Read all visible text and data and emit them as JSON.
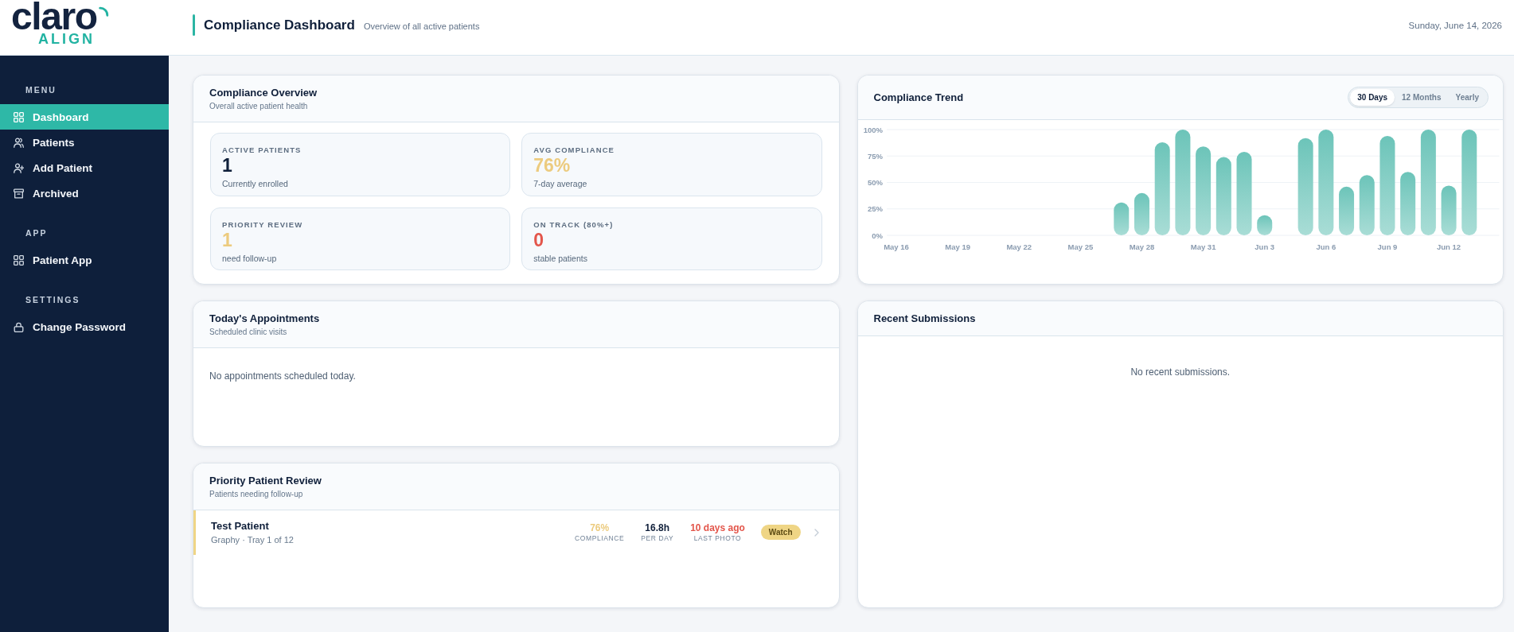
{
  "header": {
    "logo": {
      "wordmark": "claro",
      "tagline": "ALIGN"
    },
    "title": "Compliance Dashboard",
    "subtitle": "Overview of all active patients",
    "date": "Sunday, June 14, 2026"
  },
  "sidebar": {
    "sections": [
      {
        "title": "MENU",
        "items": [
          {
            "label": "Dashboard",
            "selected": true
          },
          {
            "label": "Patients",
            "selected": false
          },
          {
            "label": "Add Patient",
            "selected": false
          },
          {
            "label": "Archived",
            "selected": false
          }
        ]
      },
      {
        "title": "APP",
        "items": [
          {
            "label": "Patient App",
            "selected": false
          }
        ]
      },
      {
        "title": "SETTINGS",
        "items": [
          {
            "label": "Change Password",
            "selected": false
          }
        ]
      }
    ]
  },
  "compliance_overview": {
    "title": "Compliance Overview",
    "subtitle": "Overall active patient health",
    "stats": [
      {
        "label": "ACTIVE PATIENTS",
        "value": "1",
        "caption": "Currently enrolled",
        "color": "#0f1f3a"
      },
      {
        "label": "AVG COMPLIANCE",
        "value": "76%",
        "caption": "7-day average",
        "color": "#eccb7e"
      },
      {
        "label": "PRIORITY REVIEW",
        "value": "1",
        "caption": "need follow-up",
        "color": "#eccb7e"
      },
      {
        "label": "ON TRACK (80%+)",
        "value": "0",
        "caption": "stable patients",
        "color": "#e3564b"
      }
    ]
  },
  "compliance_trend": {
    "title": "Compliance Trend",
    "ranges": [
      {
        "label": "30 Days",
        "selected": true
      },
      {
        "label": "12 Months",
        "selected": false
      },
      {
        "label": "Yearly",
        "selected": false
      }
    ],
    "chart_data": {
      "type": "bar",
      "categories": [
        "May 16",
        null,
        null,
        "May 19",
        null,
        null,
        "May 22",
        null,
        null,
        "May 25",
        null,
        null,
        "May 28",
        null,
        null,
        "May 31",
        null,
        null,
        "Jun 3",
        null,
        null,
        "Jun 6",
        null,
        null,
        "Jun 9",
        null,
        null,
        "Jun 12",
        null,
        null
      ],
      "values": [
        null,
        null,
        null,
        null,
        null,
        null,
        null,
        null,
        null,
        null,
        null,
        31,
        40,
        88,
        100,
        84,
        74,
        79,
        19,
        null,
        92,
        100,
        46,
        57,
        94,
        60,
        100,
        47,
        100,
        null
      ],
      "ylim": [
        0,
        100
      ],
      "yticks": [
        {
          "value": 0,
          "label": "0%"
        },
        {
          "value": 25,
          "label": "25%"
        },
        {
          "value": 50,
          "label": "50%"
        },
        {
          "value": 75,
          "label": "75%"
        },
        {
          "value": 100,
          "label": "100%"
        }
      ],
      "grid": true
    }
  },
  "appointments": {
    "title": "Today's Appointments",
    "subtitle": "Scheduled clinic visits",
    "empty_message": "No appointments scheduled today."
  },
  "priority_review": {
    "title": "Priority Patient Review",
    "subtitle": "Patients needing follow-up",
    "patients": [
      {
        "name": "Test Patient",
        "detail": "Graphy · Tray 1 of 12",
        "metrics": [
          {
            "value": "76%",
            "label": "COMPLIANCE",
            "color": "#eccb7e"
          },
          {
            "value": "16.8h",
            "label": "PER DAY",
            "color": "#0f1f3a"
          },
          {
            "value": "10 days ago",
            "label": "LAST PHOTO",
            "color": "#e3564b"
          }
        ],
        "status": {
          "label": "Watch",
          "color": "#efd585"
        }
      }
    ]
  },
  "recent_submissions": {
    "title": "Recent Submissions",
    "empty_message": "No recent submissions."
  }
}
